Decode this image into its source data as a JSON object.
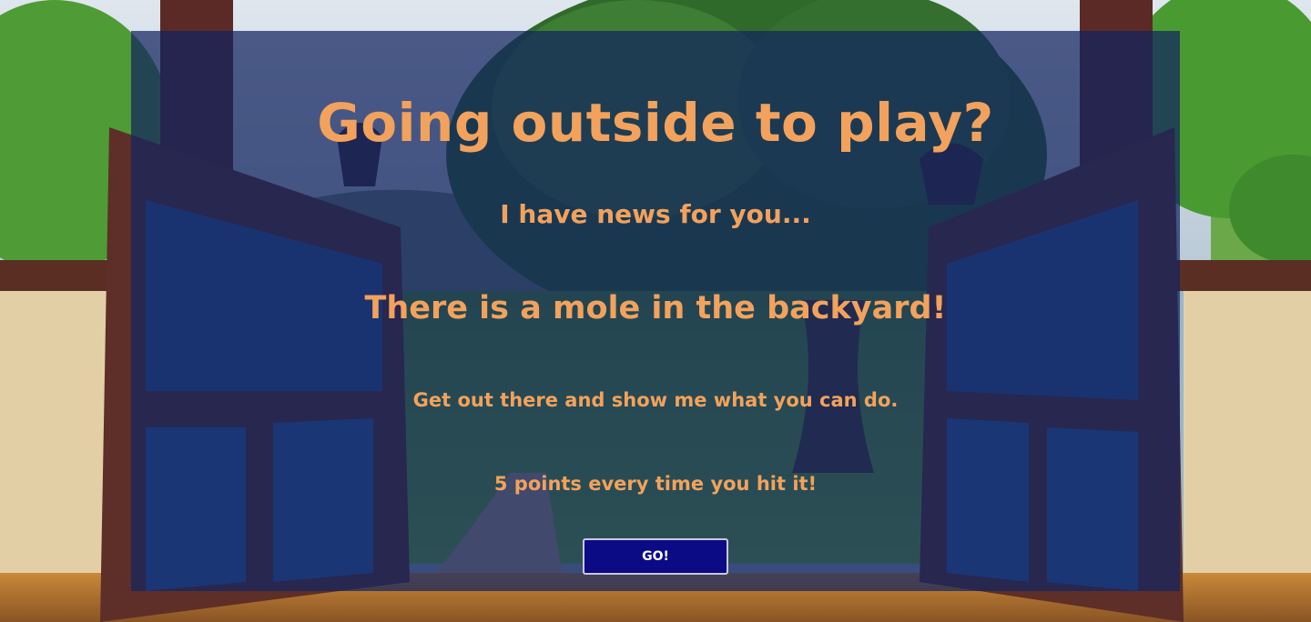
{
  "intro": {
    "title": "Going outside to play?",
    "news_line": "I have news for you...",
    "mole_line": "There is a mole in the backyard!",
    "challenge_line": "Get out there and show me what you can do.",
    "points_line": "5 points every time you hit it!",
    "go_button_label": "GO!"
  },
  "colors": {
    "text_accent": "#f2a25c",
    "panel_overlay": "rgba(18, 36, 96, 0.72)",
    "button_bg": "#0b0b86",
    "button_border": "#c9c9e6"
  },
  "background": {
    "scene": "open wooden gates onto a green backyard with a large tree and hills"
  }
}
